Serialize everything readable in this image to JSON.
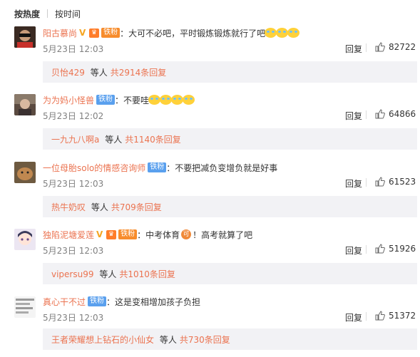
{
  "sort": {
    "hot_label": "按热度",
    "time_label": "按时间"
  },
  "comments": [
    {
      "user": "阳古慕尚",
      "fan_badge": "铁粉",
      "text": "大可不必吧，平时锻炼锻炼就行了吧",
      "date": "5月23日 12:03",
      "reply_label": "回复",
      "likes": "82722",
      "sub_users": "贝怡429",
      "sub_mid": "等人",
      "sub_link": "共2914条回复"
    },
    {
      "user": "为为妈小怪兽",
      "fan_badge": "铁粉",
      "text": "不要哇",
      "date": "5月23日 12:02",
      "reply_label": "回复",
      "likes": "64866",
      "sub_users": "一九九八啊a",
      "sub_mid": "等人",
      "sub_link": "共1140条回复"
    },
    {
      "user": "一位母胎solo的情感咨询师",
      "fan_badge": "铁粉",
      "text": "不要把减负变增负就是好事",
      "date": "5月23日 12:03",
      "reply_label": "回复",
      "likes": "61523",
      "sub_users": "热牛奶叹",
      "sub_mid": "等人",
      "sub_link": "共709条回复"
    },
    {
      "user": "独陷泥塘爱莲",
      "fan_badge": "铁粉",
      "text_a": "中考体育",
      "text_icon": "可",
      "text_b": "！高考就算了吧",
      "date": "5月23日 12:03",
      "reply_label": "回复",
      "likes": "51926",
      "sub_users": "vipersu99",
      "sub_mid": "等人",
      "sub_link": "共1010条回复"
    },
    {
      "user": "真心干不过",
      "fan_badge": "铁粉",
      "text": "这是变相增加孩子负担",
      "date": "5月23日 12:03",
      "reply_label": "回复",
      "likes": "51372",
      "sub_users": "王者荣耀想上钻石的小仙女",
      "sub_mid": "等人",
      "sub_link": "共730条回复"
    }
  ],
  "colors": {
    "username": "#eb7350",
    "fan_blue": "#5aa0ee",
    "fan_orange": "#f78c2c",
    "subbox_bg": "#f2f2f5"
  },
  "icons": {
    "like": "thumb-up-icon",
    "verified": "verified-v-icon",
    "emoji": "laugh-cry-emoji-icon"
  }
}
